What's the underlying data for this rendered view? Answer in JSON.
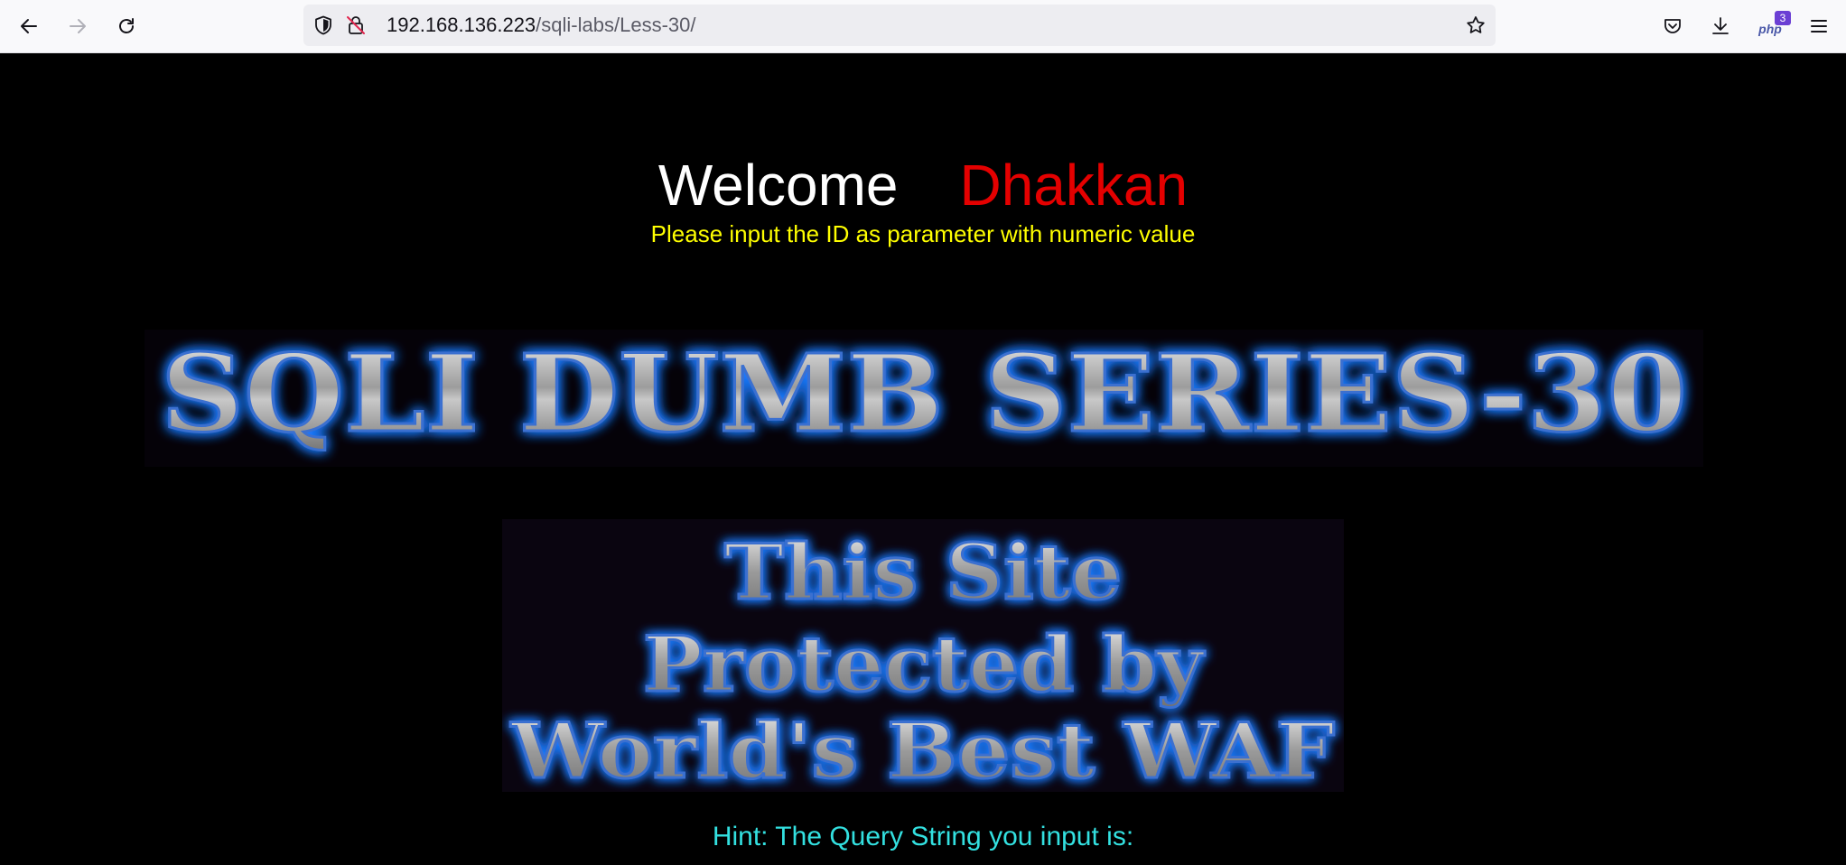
{
  "browser": {
    "url_host": "192.168.136.223",
    "url_path": "/sqli-labs/Less-30/",
    "icons": {
      "back": "back-arrow-icon",
      "forward": "forward-arrow-icon",
      "reload": "reload-icon",
      "shield": "tracking-shield-icon",
      "insecure": "insecure-lock-icon",
      "bookmark": "star-icon",
      "pocket": "pocket-icon",
      "downloads": "download-icon",
      "extension": "php-extension-icon",
      "menu": "hamburger-menu-icon"
    },
    "extension_badge": "3",
    "extension_label": "php"
  },
  "page": {
    "welcome": "Welcome",
    "name": "Dhakkan",
    "subtitle": "Please input the ID as parameter with numeric value",
    "banner_title": "SQLI DUMB SERIES-30",
    "waf_line1": "This Site",
    "waf_line2": "Protected by",
    "waf_line3": "World's Best WAF",
    "hint": "Hint: The Query String you input is:",
    "colors": {
      "background": "#000000",
      "welcome": "#ffffff",
      "name": "#e40000",
      "subtitle": "#ffff00",
      "hint": "#33e0e0",
      "glow": "#1e7bff"
    }
  }
}
